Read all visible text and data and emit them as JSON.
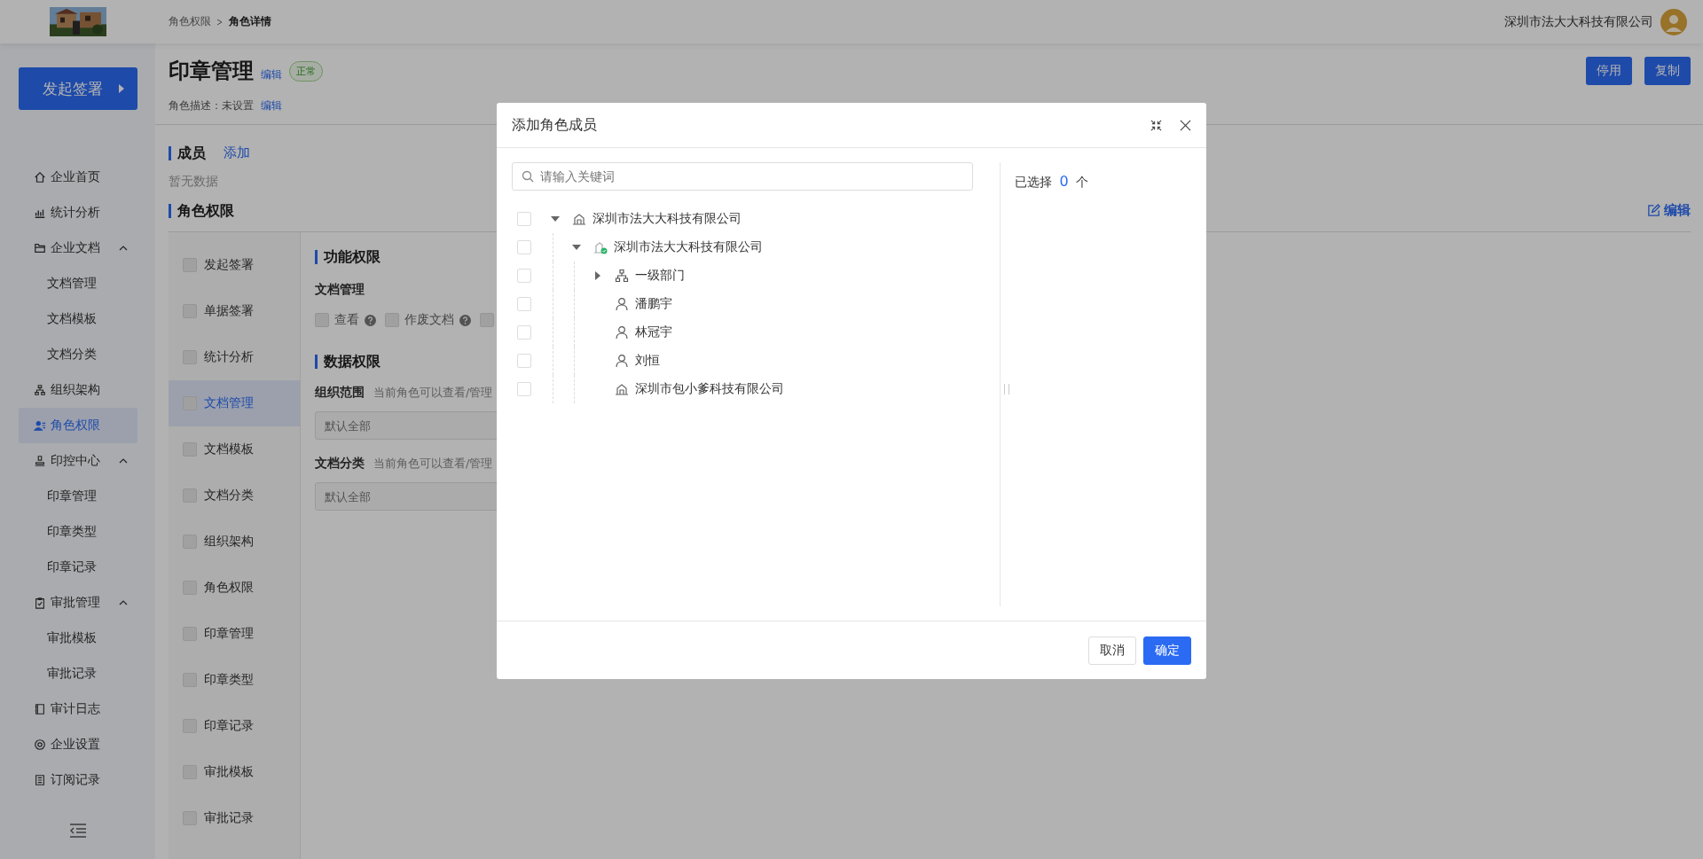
{
  "header": {
    "breadcrumb": [
      {
        "label": "角色权限",
        "current": false
      },
      {
        "label": "角色详情",
        "current": true
      }
    ],
    "company": "深圳市法大大科技有限公司"
  },
  "sidebar": {
    "launch_button": "发起签署",
    "items": [
      {
        "label": "企业首页",
        "selected": false
      },
      {
        "label": "统计分析",
        "selected": false
      },
      {
        "label": "企业文档",
        "selected": false,
        "expanded": true,
        "children": [
          {
            "label": "文档管理",
            "selected": false
          },
          {
            "label": "文档模板",
            "selected": false
          },
          {
            "label": "文档分类",
            "selected": false
          }
        ]
      },
      {
        "label": "组织架构",
        "selected": false
      },
      {
        "label": "角色权限",
        "selected": true
      },
      {
        "label": "印控中心",
        "selected": false,
        "expanded": true,
        "children": [
          {
            "label": "印章管理",
            "selected": false
          },
          {
            "label": "印章类型",
            "selected": false
          },
          {
            "label": "印章记录",
            "selected": false
          }
        ]
      },
      {
        "label": "审批管理",
        "selected": false,
        "expanded": true,
        "children": [
          {
            "label": "审批模板",
            "selected": false
          },
          {
            "label": "审批记录",
            "selected": false
          }
        ]
      },
      {
        "label": "审计日志",
        "selected": false
      },
      {
        "label": "企业设置",
        "selected": false
      },
      {
        "label": "订阅记录",
        "selected": false
      }
    ]
  },
  "role": {
    "title": "印章管理",
    "title_edit": "编辑",
    "status": "正常",
    "description_label": "角色描述：未设置",
    "description_edit": "编辑",
    "buttons": [
      "停用",
      "复制"
    ]
  },
  "members": {
    "title": "成员",
    "add": "添加",
    "empty": "暂无数据"
  },
  "permissions": {
    "title": "角色权限",
    "edit": "编辑",
    "modules": [
      {
        "label": "发起签署",
        "selected": false,
        "disabled": true
      },
      {
        "label": "单据签署",
        "selected": false,
        "disabled": true
      },
      {
        "label": "统计分析",
        "selected": false,
        "disabled": true
      },
      {
        "label": "文档管理",
        "selected": true,
        "disabled": true
      },
      {
        "label": "文档模板",
        "selected": false,
        "disabled": true
      },
      {
        "label": "文档分类",
        "selected": false,
        "disabled": true
      },
      {
        "label": "组织架构",
        "selected": false,
        "disabled": true
      },
      {
        "label": "角色权限",
        "selected": false,
        "disabled": true
      },
      {
        "label": "印章管理",
        "selected": false,
        "disabled": true
      },
      {
        "label": "印章类型",
        "selected": false,
        "disabled": true
      },
      {
        "label": "印章记录",
        "selected": false,
        "disabled": true
      },
      {
        "label": "审批模板",
        "selected": false,
        "disabled": true
      },
      {
        "label": "审批记录",
        "selected": false,
        "disabled": true
      }
    ],
    "function_title": "功能权限",
    "function_group": "文档管理",
    "function_options": [
      {
        "label": "查看",
        "disabled": true
      },
      {
        "label": "作废文档",
        "disabled": true
      },
      {
        "disabled": true
      }
    ],
    "data_title": "数据权限",
    "data_fields": [
      {
        "label": "组织范围",
        "hint": "当前角色可以查看/管理",
        "placeholder": "默认全部"
      },
      {
        "label": "文档分类",
        "hint": "当前角色可以查看/管理",
        "placeholder": "默认全部"
      }
    ]
  },
  "dialog": {
    "title": "添加角色成员",
    "search_placeholder": "请输入关键词",
    "tree": [
      {
        "label": "深圳市法大大科技有限公司",
        "kind": "company",
        "checked": false,
        "expanded": true,
        "children": [
          {
            "label": "深圳市法大大科技有限公司",
            "kind": "verified",
            "checked": false,
            "expanded": true,
            "children": [
              {
                "label": "一级部门",
                "kind": "department",
                "checked": false,
                "expanded": false
              },
              {
                "label": "潘鹏宇",
                "kind": "person",
                "checked": false
              },
              {
                "label": "林冠宇",
                "kind": "person",
                "checked": false
              },
              {
                "label": "刘恒",
                "kind": "person",
                "checked": false
              },
              {
                "label": "深圳市包小爹科技有限公司",
                "kind": "company",
                "checked": false
              }
            ]
          }
        ]
      }
    ],
    "selected_prefix": "已选择",
    "selected_count": "0",
    "selected_suffix": "个",
    "buttons": [
      {
        "label": "取消",
        "primary": false
      },
      {
        "label": "确定",
        "primary": true
      }
    ]
  }
}
